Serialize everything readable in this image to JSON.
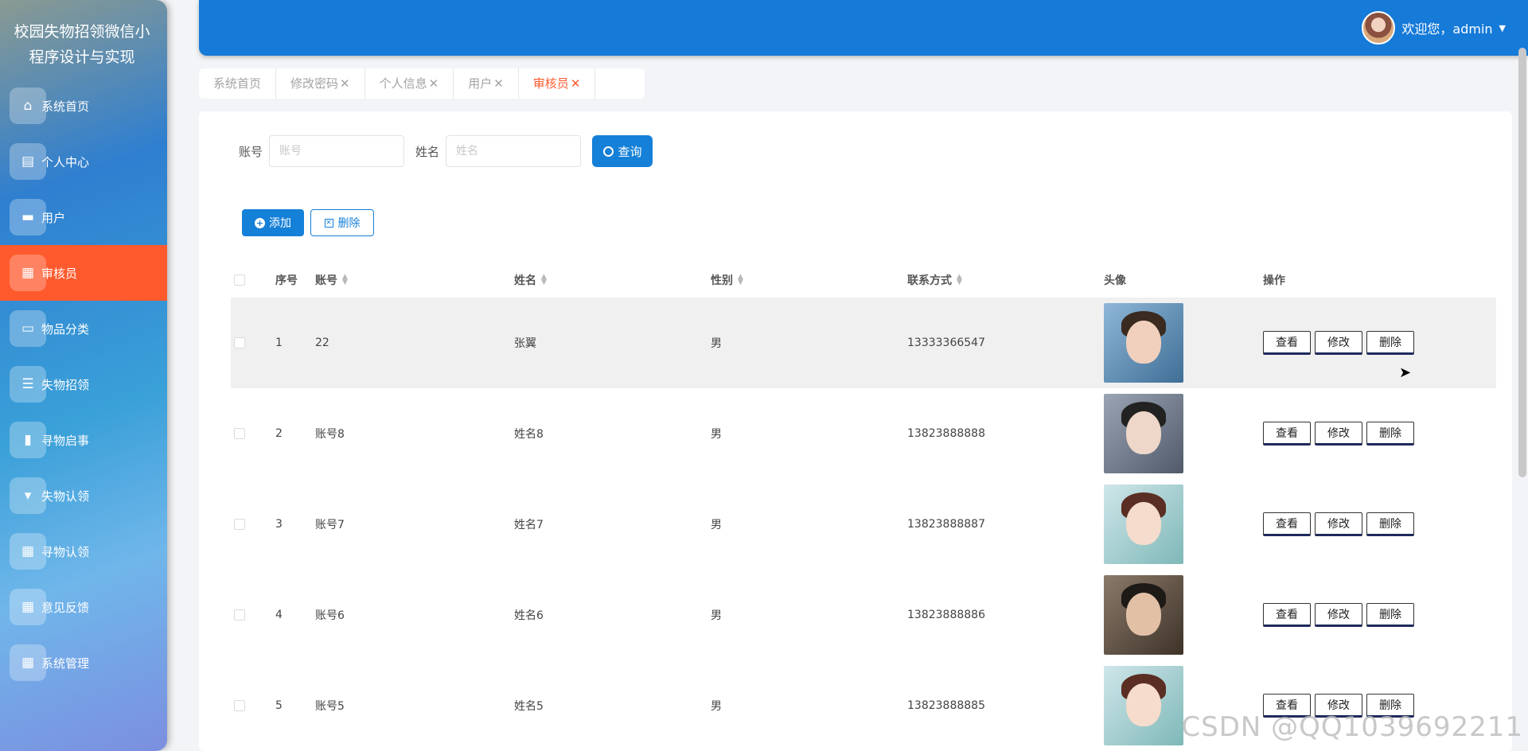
{
  "sidebar": {
    "title": "校园失物招领微信小程序设计与实现",
    "items": [
      {
        "label": "系统首页",
        "icon": "home-icon",
        "glyph": "⌂"
      },
      {
        "label": "个人中心",
        "icon": "id-card-icon",
        "glyph": "▤"
      },
      {
        "label": "用户",
        "icon": "briefcase-icon",
        "glyph": "▬"
      },
      {
        "label": "审核员",
        "icon": "grid-icon",
        "glyph": "▦",
        "active": true
      },
      {
        "label": "物品分类",
        "icon": "card-icon",
        "glyph": "▭"
      },
      {
        "label": "失物招领",
        "icon": "list-icon",
        "glyph": "☰"
      },
      {
        "label": "寻物启事",
        "icon": "bookmark-icon",
        "glyph": "▮"
      },
      {
        "label": "失物认领",
        "icon": "pin-icon",
        "glyph": "▾"
      },
      {
        "label": "寻物认领",
        "icon": "grid-icon",
        "glyph": "▦"
      },
      {
        "label": "意见反馈",
        "icon": "grid-icon",
        "glyph": "▦"
      },
      {
        "label": "系统管理",
        "icon": "grid-icon",
        "glyph": "▦"
      }
    ]
  },
  "header": {
    "welcome": "欢迎您，admin",
    "colors": {
      "header_bg": "#157ad8",
      "active_menu": "#ff5a2e",
      "accent": "#1580d8"
    }
  },
  "tabs": [
    {
      "label": "系统首页",
      "closable": false,
      "active": false
    },
    {
      "label": "修改密码",
      "closable": true,
      "active": false
    },
    {
      "label": "个人信息",
      "closable": true,
      "active": false
    },
    {
      "label": "用户",
      "closable": true,
      "active": false
    },
    {
      "label": "审核员",
      "closable": true,
      "active": true
    }
  ],
  "search": {
    "account_label": "账号",
    "account_placeholder": "账号",
    "name_label": "姓名",
    "name_placeholder": "姓名",
    "query_button": "查询"
  },
  "actions": {
    "add_button": "添加",
    "delete_button": "删除"
  },
  "table": {
    "headers": {
      "no": "序号",
      "account": "账号",
      "name": "姓名",
      "sex": "性别",
      "phone": "联系方式",
      "avatar": "头像",
      "ops": "操作"
    },
    "op_labels": {
      "view": "查看",
      "edit": "修改",
      "delete": "删除"
    },
    "rows": [
      {
        "no": "1",
        "account": "22",
        "name": "张翼",
        "sex": "男",
        "phone": "13333366547"
      },
      {
        "no": "2",
        "account": "账号8",
        "name": "姓名8",
        "sex": "男",
        "phone": "13823888888"
      },
      {
        "no": "3",
        "account": "账号7",
        "name": "姓名7",
        "sex": "男",
        "phone": "13823888887"
      },
      {
        "no": "4",
        "account": "账号6",
        "name": "姓名6",
        "sex": "男",
        "phone": "13823888886"
      },
      {
        "no": "5",
        "account": "账号5",
        "name": "姓名5",
        "sex": "男",
        "phone": "13823888885"
      }
    ]
  },
  "watermark": "CSDN @QQ1039692211"
}
